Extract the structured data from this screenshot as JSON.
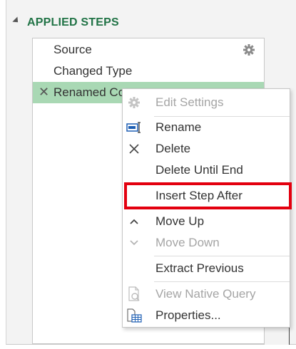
{
  "section": {
    "title": "APPLIED STEPS"
  },
  "steps": [
    {
      "label": "Source",
      "has_settings": true
    },
    {
      "label": "Changed Type",
      "has_settings": false
    },
    {
      "label": "Renamed Co",
      "selected": true,
      "deletable": true
    }
  ],
  "context_menu": {
    "items": {
      "edit_settings": {
        "label": "Edit Settings",
        "enabled": false,
        "icon": "gear-icon"
      },
      "rename": {
        "label": "Rename",
        "enabled": true,
        "icon": "rename-icon"
      },
      "delete": {
        "label": "Delete",
        "enabled": true,
        "icon": "close-icon"
      },
      "delete_until_end": {
        "label": "Delete Until End",
        "enabled": true
      },
      "insert_step_after": {
        "label": "Insert Step After",
        "enabled": true,
        "highlighted": true
      },
      "move_up": {
        "label": "Move Up",
        "enabled": true,
        "icon": "chevron-up-icon"
      },
      "move_down": {
        "label": "Move Down",
        "enabled": false,
        "icon": "chevron-down-icon"
      },
      "extract_previous": {
        "label": "Extract Previous",
        "enabled": true
      },
      "view_native_query": {
        "label": "View Native Query",
        "enabled": false,
        "icon": "document-icon"
      },
      "properties": {
        "label": "Properties...",
        "enabled": true,
        "icon": "properties-icon"
      }
    }
  },
  "colors": {
    "section_title": "#217346",
    "selected_row": "#a9d8b4",
    "highlight_box": "#e3000f",
    "disabled_text": "#a5a5a5"
  }
}
